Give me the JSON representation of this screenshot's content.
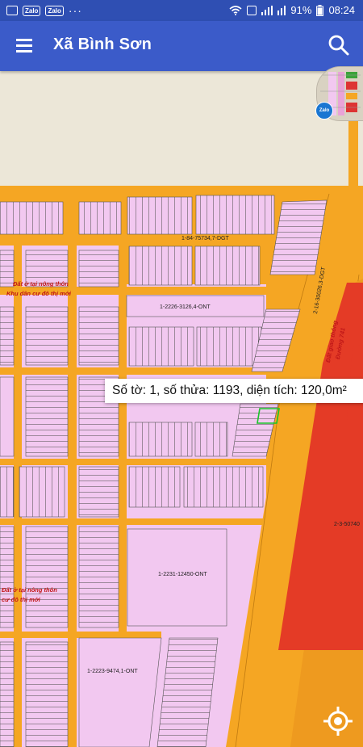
{
  "status_bar": {
    "left_icons": [
      "image-icon",
      "zalo-icon",
      "zalo-icon",
      "more-dots-icon"
    ],
    "zalo_label": "Zalo",
    "more_label": "···",
    "battery": "91%",
    "time": "08:24"
  },
  "app_bar": {
    "title": "Xã Bình Sơn",
    "menu_icon": "hamburger-menu-icon",
    "search_icon": "search-icon"
  },
  "map": {
    "colors": {
      "residential": "#f2c8f0",
      "road": "#f5a623",
      "transport_land": "#ee9a1f",
      "red_zone": "#e43b26",
      "background": "#ece7d8",
      "selected_outline": "#19c42a"
    },
    "labels": {
      "road_top": "1-84-75734,7-DGT",
      "road_diag": "2-16-30026,3-DGT",
      "parcel_ont_1": "1-2226-3126,4-ONT",
      "parcel_ont_2": "1-2231-12450-ONT",
      "parcel_ont_3": "1-2223-9474,1-ONT",
      "red_zone_code": "2-3-50740",
      "land_use_1a": "Đất ở tại nông thôn",
      "land_use_1b": "Khu dân cư đô thị mới",
      "land_use_2a": "Đất ở tại nông thôn",
      "land_use_2b": "cư đô thị mới",
      "transport_1": "Đất giao thông",
      "transport_2": "Đường 741"
    }
  },
  "popup": {
    "text": "Số tờ: 1, số thửa: 1193, diện tích: 120,0m²"
  },
  "controls": {
    "locate_icon": "gps-locate-icon",
    "minimap_badge": "Zalo"
  }
}
